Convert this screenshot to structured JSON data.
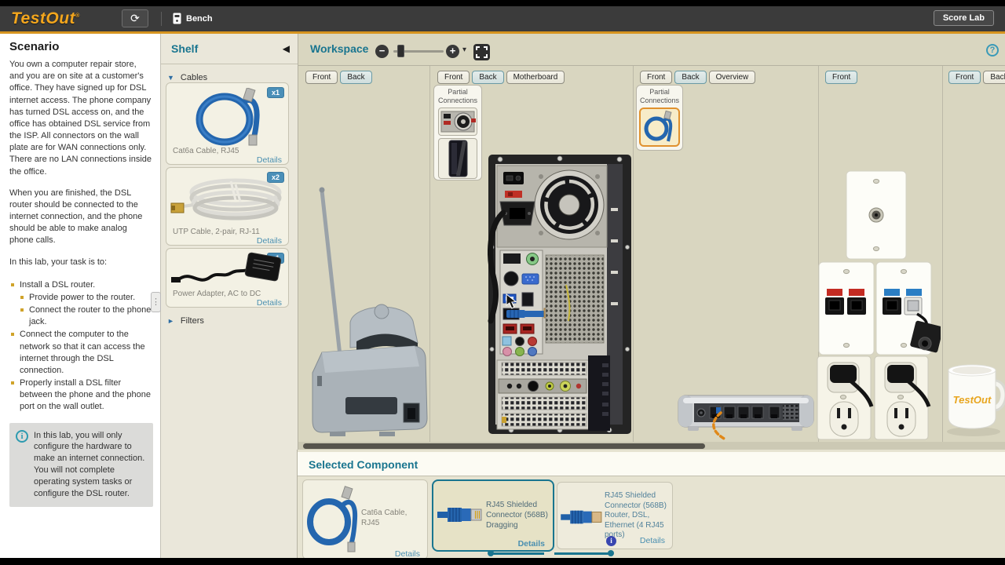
{
  "header": {
    "logo": "TestOut",
    "logo_reg": "®",
    "bench": "Bench",
    "score_lab": "Score Lab"
  },
  "glyphs": {
    "refresh": "⟳",
    "panel_collapse": "◀",
    "section_expanded": "▼",
    "section_collapsed": "►",
    "minus": "−",
    "plus": "+",
    "caret_down": "▾",
    "help": "?",
    "info": "i",
    "ellipsis": "⋮"
  },
  "scenario": {
    "title": "Scenario",
    "p1": "You own a computer repair store, and you are on site at a customer's office. They have signed up for DSL internet access. The phone company has turned DSL access on, and the office has obtained DSL service from the ISP. All connectors on the wall plate are for WAN connections only. There are no LAN connections inside the office.",
    "p2": "When you are finished, the DSL router should be connected to the internet connection, and the phone should be able to make analog phone calls.",
    "task_intro": "In this lab, your task is to:",
    "tasks": {
      "t1": "Install a DSL router.",
      "t1a": "Provide power to the router.",
      "t1b": "Connect the router to the phone jack.",
      "t2": "Connect the computer to the network so that it can access the internet through the DSL connection.",
      "t3": "Properly install a DSL filter between the phone and the phone port on the wall outlet."
    },
    "note": "In this lab, you will only configure the hardware to make an internet connection. You will not complete operating system tasks or configure the DSL router."
  },
  "shelf": {
    "title": "Shelf",
    "cables_section": "Cables",
    "filters_section": "Filters",
    "details_label": "Details",
    "items": [
      {
        "name": "Cat6a Cable, RJ45",
        "count": "x1"
      },
      {
        "name": "UTP Cable, 2-pair, RJ-11",
        "count": "x2"
      },
      {
        "name": "Power Adapter, AC to DC",
        "count": "x1"
      }
    ]
  },
  "workspace": {
    "title": "Workspace",
    "partial_connections_label": "Partial Connections",
    "mug_logo": "TestOut",
    "areas": {
      "phone": {
        "front": "Front",
        "back": "Back"
      },
      "computer": {
        "front": "Front",
        "back": "Back",
        "motherboard": "Motherboard"
      },
      "router": {
        "front": "Front",
        "back": "Back",
        "overview": "Overview"
      },
      "wall_plate": {
        "front": "Front"
      },
      "desk": {
        "front": "Front",
        "back": "Back"
      }
    }
  },
  "selected_component": {
    "title": "Selected Component",
    "details_label": "Details",
    "cards": [
      {
        "label": "Cat6a Cable, RJ45"
      },
      {
        "label": "RJ45 Shielded Connector (568B)",
        "status": "Dragging"
      },
      {
        "label": "RJ45 Shielded Connector (568B)",
        "sub": "Router, DSL, Ethernet (4 RJ45 ports)"
      }
    ]
  },
  "colors": {
    "accent_teal": "#19758f",
    "gold": "#d6941f",
    "badge_blue": "#4a8fb8",
    "selection_orange": "#e0912e",
    "link_blue": "#4a8fb0",
    "cable_blue": "#2466ae"
  }
}
